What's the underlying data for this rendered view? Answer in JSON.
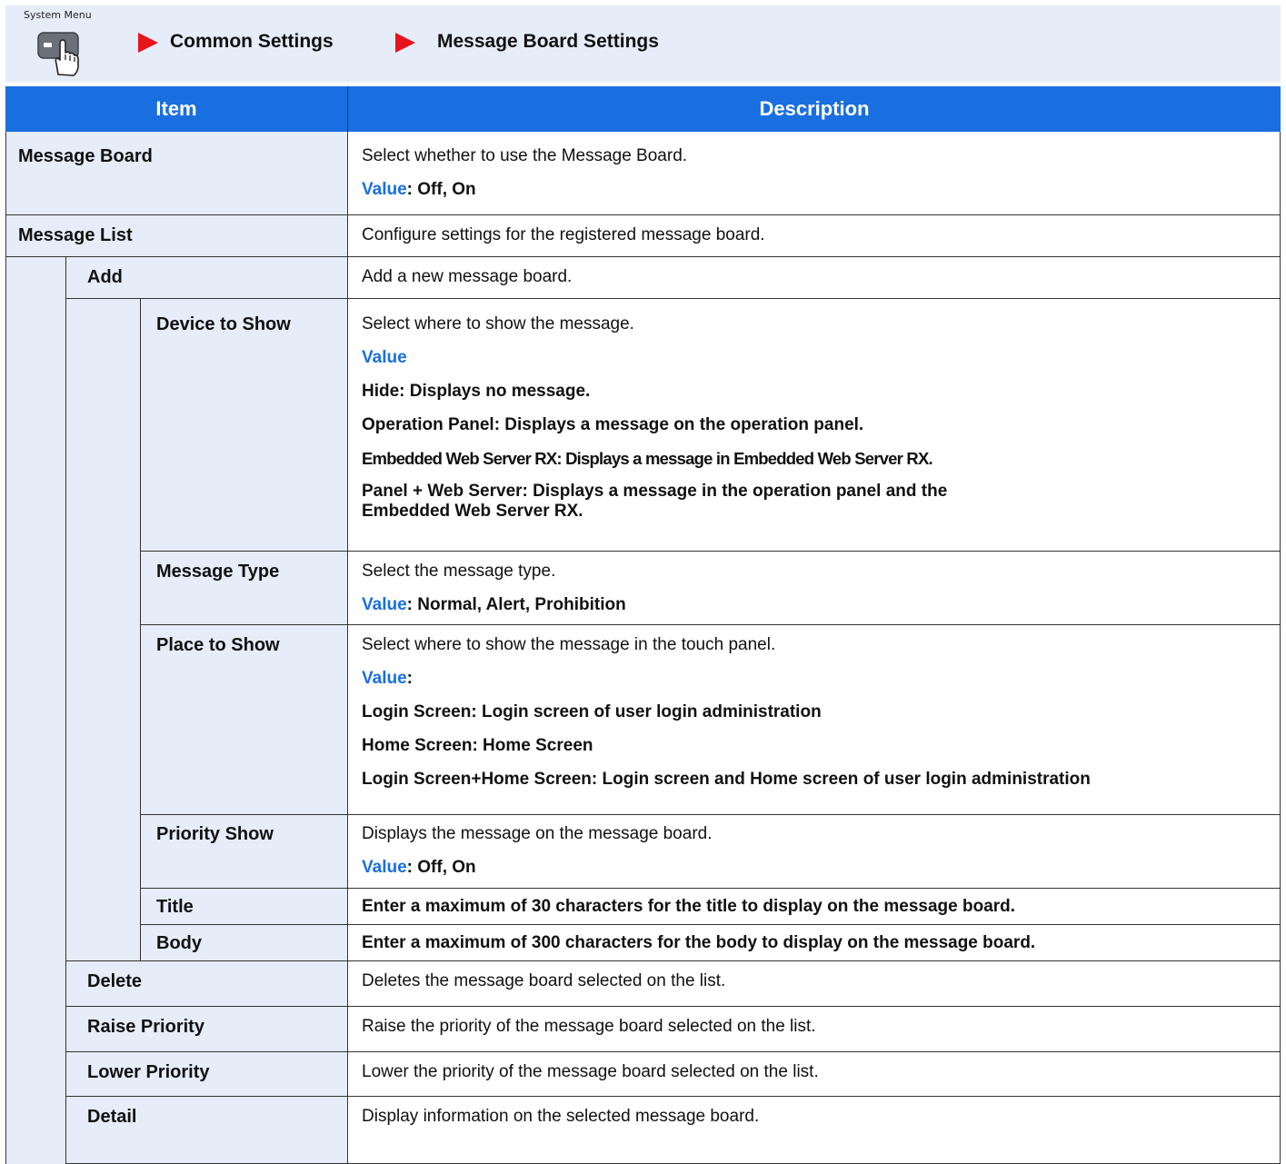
{
  "breadcrumb": {
    "system_menu_label": "System Menu",
    "icon": "hand-press-key-icon",
    "crumbs": [
      "Common Settings",
      "Message Board Settings"
    ],
    "arrow_color": "#e8141b",
    "band_color": "#e6ecf8"
  },
  "table": {
    "header_color": "#1a6fe0",
    "value_color": "#1a6fe0",
    "headers": {
      "item": "Item",
      "description": "Description"
    },
    "rows": {
      "message_board": {
        "item": "Message Board",
        "desc": "Select whether to use the Message Board.",
        "value_label": "Value",
        "value_text": ": Off, On"
      },
      "message_list": {
        "item": "Message List",
        "desc": "Configure settings for the registered message board."
      },
      "add": {
        "item": "Add",
        "desc": "Add a new message board."
      },
      "device_to_show": {
        "item": "Device to Show",
        "desc": "Select where to show the message.",
        "value_label": "Value",
        "opt1": "Hide: Displays no message.",
        "opt2": "Operation Panel: Displays a message on the operation panel.",
        "opt3": "Embedded Web Server RX: Displays a message in Embedded Web Server RX.",
        "opt4a": "Panel + Web Server: Displays a message in the operation panel and the",
        "opt4b": "Embedded Web Server RX."
      },
      "message_type": {
        "item": "Message Type",
        "desc": "Select the message type.",
        "value_label": "Value",
        "value_text": ": Normal, Alert, Prohibition"
      },
      "place_to_show": {
        "item": "Place to Show",
        "desc": "Select where to show the message in the touch panel.",
        "value_label": "Value",
        "value_text": ":",
        "opt1": "Login Screen: Login screen of user login administration",
        "opt2": "Home Screen: Home Screen",
        "opt3": "Login Screen+Home Screen: Login screen and Home screen of user login administration"
      },
      "priority_show": {
        "item": "Priority Show",
        "desc": "Displays the message on the message board.",
        "value_label": "Value",
        "value_text": ": Off, On"
      },
      "title": {
        "item": "Title",
        "desc": "Enter a maximum of 30 characters for the title to display on the message board."
      },
      "body": {
        "item": "Body",
        "desc": "Enter a maximum of 300 characters for the body to display on the message board."
      },
      "delete": {
        "item": "Delete",
        "desc": "Deletes the message board selected on the list."
      },
      "raise_priority": {
        "item": "Raise Priority",
        "desc": "Raise the priority of the message board selected on the list."
      },
      "lower_priority": {
        "item": "Lower Priority",
        "desc": "Lower the priority of the message board selected on the list."
      },
      "detail": {
        "item": "Detail",
        "desc": "Display information on the selected message board."
      }
    }
  }
}
